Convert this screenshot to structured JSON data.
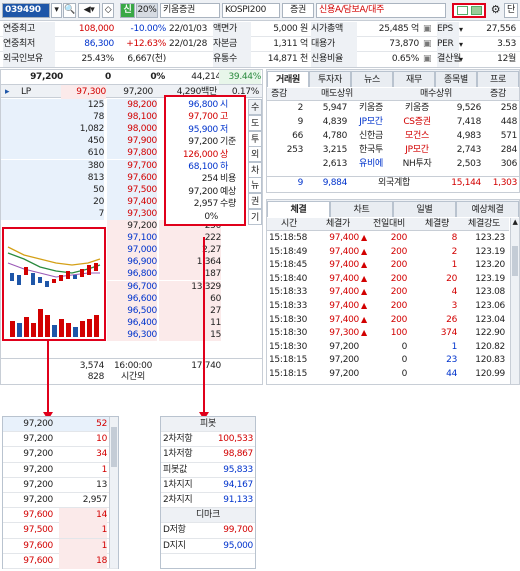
{
  "toolbar": {
    "code": "039490",
    "credit_badge": "신",
    "margin_rate": "20%",
    "stock_name": "키움증권",
    "market": "KOSPI200",
    "sector": "증권",
    "credit_info": "신용A/담보A/대주",
    "right_label": "단"
  },
  "summary": {
    "rows": [
      {
        "l1": "연중최고",
        "v1": "108,000",
        "v2": "-10.00%",
        "d": "22/01/03",
        "l2": "액면가",
        "v3": "5,000 원",
        "l3": "시가총액",
        "v4": "25,485 억",
        "l4": "EPS",
        "v5": "27,556"
      },
      {
        "l1": "연중최저",
        "v1": "86,300",
        "v2": "+12.63%",
        "d": "22/01/28",
        "l2": "자본금",
        "v3": "1,311 억",
        "l3": "대용가",
        "v4": "73,870",
        "l4": "PER",
        "v5": "3.53"
      },
      {
        "l1": "외국인보유",
        "v1": "25.43%",
        "v2": "6,667(천)",
        "d": "",
        "l2": "유통수",
        "v3": "14,871 천",
        "l3": "신용비율",
        "v4": "0.65%",
        "l4": "결산월",
        "v5": "12월"
      }
    ]
  },
  "orderbook": {
    "price": "97,200",
    "change": "0",
    "change_pct": "0%",
    "volume": "44,214",
    "vol_ratio": "39.44%",
    "lp_label": "LP",
    "lp_price": "97,300",
    "lp_price2": "97,200",
    "amount": "4,290백만",
    "amount_pct": "0.17%",
    "asks": [
      {
        "qty": "125",
        "price": "98,200"
      },
      {
        "qty": "78",
        "price": "98,100"
      },
      {
        "qty": "1,082",
        "price": "98,000"
      },
      {
        "qty": "450",
        "price": "97,900"
      },
      {
        "qty": "610",
        "price": "97,800"
      },
      {
        "qty": "380",
        "price": "97,700"
      },
      {
        "qty": "813",
        "price": "97,600"
      },
      {
        "qty": "50",
        "price": "97,500"
      },
      {
        "qty": "20",
        "price": "97,400"
      },
      {
        "qty": "7",
        "price": "97,300"
      }
    ],
    "bids": [
      {
        "price": "97,200",
        "qty": "250"
      },
      {
        "price": "97,100",
        "qty": "222"
      },
      {
        "price": "97,000",
        "qty": "2,27"
      },
      {
        "price": "96,900",
        "qty": "1,364"
      },
      {
        "price": "96,800",
        "qty": "187"
      },
      {
        "price": "96,700",
        "qty": "13,329"
      },
      {
        "price": "96,600",
        "qty": "60"
      },
      {
        "price": "96,500",
        "qty": "27"
      },
      {
        "price": "96,400",
        "qty": "11"
      },
      {
        "price": "96,300",
        "qty": "15"
      }
    ],
    "info_box": [
      {
        "price": "96,800",
        "label": "시",
        "cls": "blue"
      },
      {
        "price": "97,700",
        "label": "고",
        "cls": "red"
      },
      {
        "price": "95,900",
        "label": "저",
        "cls": "blue"
      },
      {
        "price": "97,200",
        "label": "기준",
        "cls": ""
      },
      {
        "price": "126,000",
        "label": "상",
        "cls": "red"
      },
      {
        "price": "68,100",
        "label": "하",
        "cls": "blue"
      },
      {
        "price": "254",
        "label": "비용",
        "cls": ""
      },
      {
        "price": "97,200",
        "label": "예상",
        "cls": ""
      },
      {
        "price": "2,957",
        "label": "수량",
        "cls": ""
      },
      {
        "price": "0%",
        "label": "",
        "cls": ""
      }
    ],
    "side_tabs": [
      "도",
      "투",
      "외",
      "차",
      "뉴",
      "권",
      "기"
    ],
    "side_top": "수",
    "total_ask": "3,574",
    "time": "16:00:00",
    "total_bid": "17,740",
    "after_qty": "828",
    "after_label": "시간외"
  },
  "broker": {
    "tabs": [
      "거래원",
      "투자자",
      "뉴스",
      "재무",
      "종목별",
      "프로"
    ],
    "headers": [
      "증감",
      "매도상위",
      "매수상위",
      "증감"
    ],
    "rows": [
      {
        "d1": "2",
        "sell_qty": "5,947",
        "sell_name": "키움증",
        "buy_name": "키움증",
        "buy_qty": "9,526",
        "d2": "258"
      },
      {
        "d1": "9",
        "sell_qty": "4,839",
        "sell_name": "JP모간",
        "buy_name": "CS증권",
        "buy_qty": "7,418",
        "d2": "448"
      },
      {
        "d1": "66",
        "sell_qty": "4,780",
        "sell_name": "신한금",
        "buy_name": "모건스",
        "buy_qty": "4,983",
        "d2": "571"
      },
      {
        "d1": "253",
        "sell_qty": "3,215",
        "sell_name": "한국투",
        "buy_name": "JP모간",
        "buy_qty": "2,743",
        "d2": "284"
      },
      {
        "d1": "",
        "sell_qty": "2,613",
        "sell_name": "유비에",
        "buy_name": "NH투자",
        "buy_qty": "2,503",
        "d2": "306"
      }
    ],
    "foreign": {
      "d1": "9",
      "sell": "9,884",
      "label": "외국계합",
      "buy": "15,144",
      "d2": "1,303"
    }
  },
  "trades": {
    "tabs": [
      "체결",
      "차트",
      "일별",
      "예상체결"
    ],
    "headers": [
      "시간",
      "체결가",
      "전일대비",
      "체결량",
      "체결강도"
    ],
    "rows": [
      {
        "t": "15:18:58",
        "p": "97,400",
        "c": "200",
        "q": "8",
        "s": "123.23"
      },
      {
        "t": "15:18:49",
        "p": "97,400",
        "c": "200",
        "q": "2",
        "s": "123.19"
      },
      {
        "t": "15:18:45",
        "p": "97,400",
        "c": "200",
        "q": "1",
        "s": "123.20"
      },
      {
        "t": "15:18:40",
        "p": "97,400",
        "c": "200",
        "q": "20",
        "s": "123.19"
      },
      {
        "t": "15:18:33",
        "p": "97,400",
        "c": "200",
        "q": "4",
        "s": "123.08"
      },
      {
        "t": "15:18:33",
        "p": "97,400",
        "c": "200",
        "q": "3",
        "s": "123.06"
      },
      {
        "t": "15:18:30",
        "p": "97,400",
        "c": "200",
        "q": "26",
        "s": "123.04"
      },
      {
        "t": "15:18:30",
        "p": "97,300",
        "c": "100",
        "q": "374",
        "s": "122.90"
      },
      {
        "t": "15:18:30",
        "p": "97,200",
        "c": "0",
        "q": "1",
        "s": "120.82"
      },
      {
        "t": "15:18:15",
        "p": "97,200",
        "c": "0",
        "q": "23",
        "s": "120.83"
      },
      {
        "t": "15:18:15",
        "p": "97,200",
        "c": "0",
        "q": "44",
        "s": "120.99"
      }
    ]
  },
  "bottom_left": {
    "rows": [
      {
        "p": "97,200",
        "q": "52",
        "cls": ""
      },
      {
        "p": "97,200",
        "q": "10",
        "cls": ""
      },
      {
        "p": "97,200",
        "q": "34",
        "cls": ""
      },
      {
        "p": "97,200",
        "q": "1",
        "cls": ""
      },
      {
        "p": "97,200",
        "q": "13",
        "cls": ""
      },
      {
        "p": "97,200",
        "q": "2,957",
        "cls": ""
      },
      {
        "p": "97,600",
        "q": "14",
        "cls": "red"
      },
      {
        "p": "97,500",
        "q": "1",
        "cls": "red"
      },
      {
        "p": "97,600",
        "q": "1",
        "cls": "red"
      },
      {
        "p": "97,600",
        "q": "18",
        "cls": "red"
      }
    ]
  },
  "pivot": {
    "title": "피봇",
    "rows": [
      {
        "l": "2차저항",
        "v": "100,533",
        "cls": "red"
      },
      {
        "l": "1차저항",
        "v": "98,867",
        "cls": "red"
      },
      {
        "l": "피봇값",
        "v": "95,833",
        "cls": "blue"
      },
      {
        "l": "1차지지",
        "v": "94,167",
        "cls": "blue"
      },
      {
        "l": "2차지지",
        "v": "91,133",
        "cls": "blue"
      }
    ],
    "demark_title": "디마크",
    "demark": [
      {
        "l": "D저항",
        "v": "99,700",
        "cls": "red"
      },
      {
        "l": "D지지",
        "v": "95,000",
        "cls": "blue"
      }
    ]
  },
  "colors": {
    "red_box": "#e0001b",
    "ask_bg": "#e8f1fb",
    "bid_bg": "#fbeaea",
    "header_bg": "#eef1f5"
  }
}
